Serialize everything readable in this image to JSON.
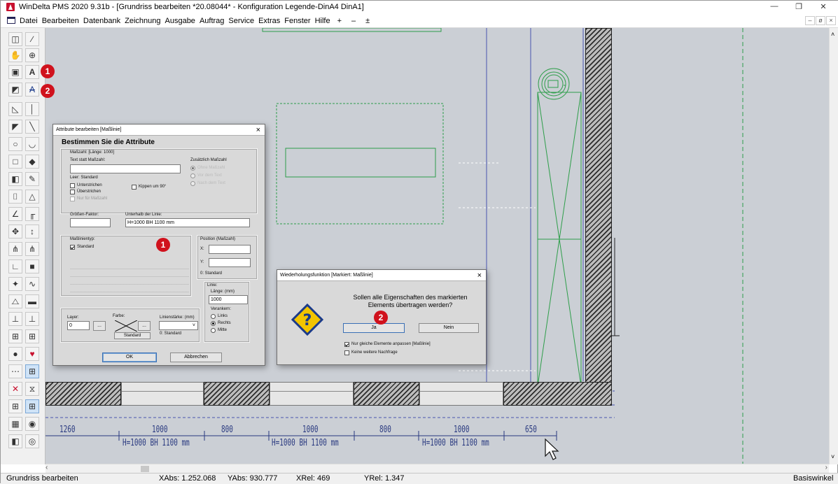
{
  "window": {
    "title": "WinDelta PMS 2020 9.31b - [Grundriss bearbeiten *20.08044* - Konfiguration Legende-DinA4 DinA1]",
    "minimize": "—",
    "restore": "❐",
    "close": "✕"
  },
  "menu": {
    "items": [
      "Datei",
      "Bearbeiten",
      "Datenbank",
      "Zeichnung",
      "Ausgabe",
      "Auftrag",
      "Service",
      "Extras",
      "Fenster",
      "Hilfe",
      "+",
      "–",
      "±"
    ],
    "mdi": [
      "–",
      "ø",
      "×"
    ]
  },
  "toolbox": {
    "badges": [
      "1",
      "2"
    ]
  },
  "drawing": {
    "dimensions": [
      "1260",
      "1000",
      "800",
      "1000",
      "800",
      "1000",
      "650"
    ],
    "dim_labels": [
      "H=1000  BH 1100 mm",
      "H=1000  BH 1100 mm",
      "H=1000  BH 1100 mm"
    ],
    "colors": {
      "dimension": "#2a3a80",
      "green": "#2e9e4a",
      "canvas": "#cbcfd5"
    }
  },
  "attr_dialog": {
    "title": "Attribute bearbeiten [Maßlinie]",
    "heading": "Bestimmen Sie die Attribute",
    "group_masszahl": "Maßzahl: [Länge: 1000]",
    "text_statt_label": "Text statt Maßzahl:",
    "leer_standard": "Leer: Standard",
    "unterstrichen": "Unterstrichen",
    "ueberstrichen": "Überstrichen",
    "nur_masszahl": "Nur für Maßzahl",
    "kippen": "Kippen um 90°",
    "zusaetzlich_label": "Zusätzlich Maßzahl",
    "zus_options": [
      "Ohne Maßzahl",
      "Vor dem Text",
      "Nach dem Text"
    ],
    "groessen_faktor": "Größen-Faktor:",
    "unterhalb_label": "Unterhalb der Linie:",
    "unterhalb_value": "H=1000  BH 1100 mm",
    "masslinientyp": "Maßlinientyp:",
    "standard": "Standard",
    "position_label": "Position (Maßzahl)",
    "x_label": "X:",
    "y_label": "Y:",
    "pos_standard": "0: Standard",
    "linie_label": "Linie:",
    "laenge_label": "Länge: (mm)",
    "laenge_value": "1000",
    "verankern_label": "Verankern:",
    "verankern_options": [
      "Links",
      "Rechts",
      "Mitte"
    ],
    "layer_label": "Layer:",
    "layer_value": "0",
    "farbe_label": "Farbe:",
    "farbe_value": "Standard",
    "linienstaerke_label": "Linienstärke: (mm)",
    "linienstaerke_value": "0: Standard",
    "more_btn": "...",
    "ok": "OK",
    "cancel": "Abbrechen",
    "badge": "1"
  },
  "repeat_dialog": {
    "title": "Wiederholungsfunktion [Markiert: Maßlinie]",
    "question": "Sollen alle Eigenschaften des markierten Elements übertragen werden?",
    "yes": "Ja",
    "no": "Nein",
    "check1": "Nur gleiche Elemente anpassen [Maßlinie]",
    "check2": "Keine weitere Nachfrage",
    "badge": "2"
  },
  "status": {
    "mode": "Grundriss bearbeiten",
    "xabs": "XAbs: 1.252.068",
    "yabs": "YAbs: 930.777",
    "xrel": "XRel: 469",
    "yrel": "YRel: 1.347",
    "right": "Basiswinkel"
  }
}
